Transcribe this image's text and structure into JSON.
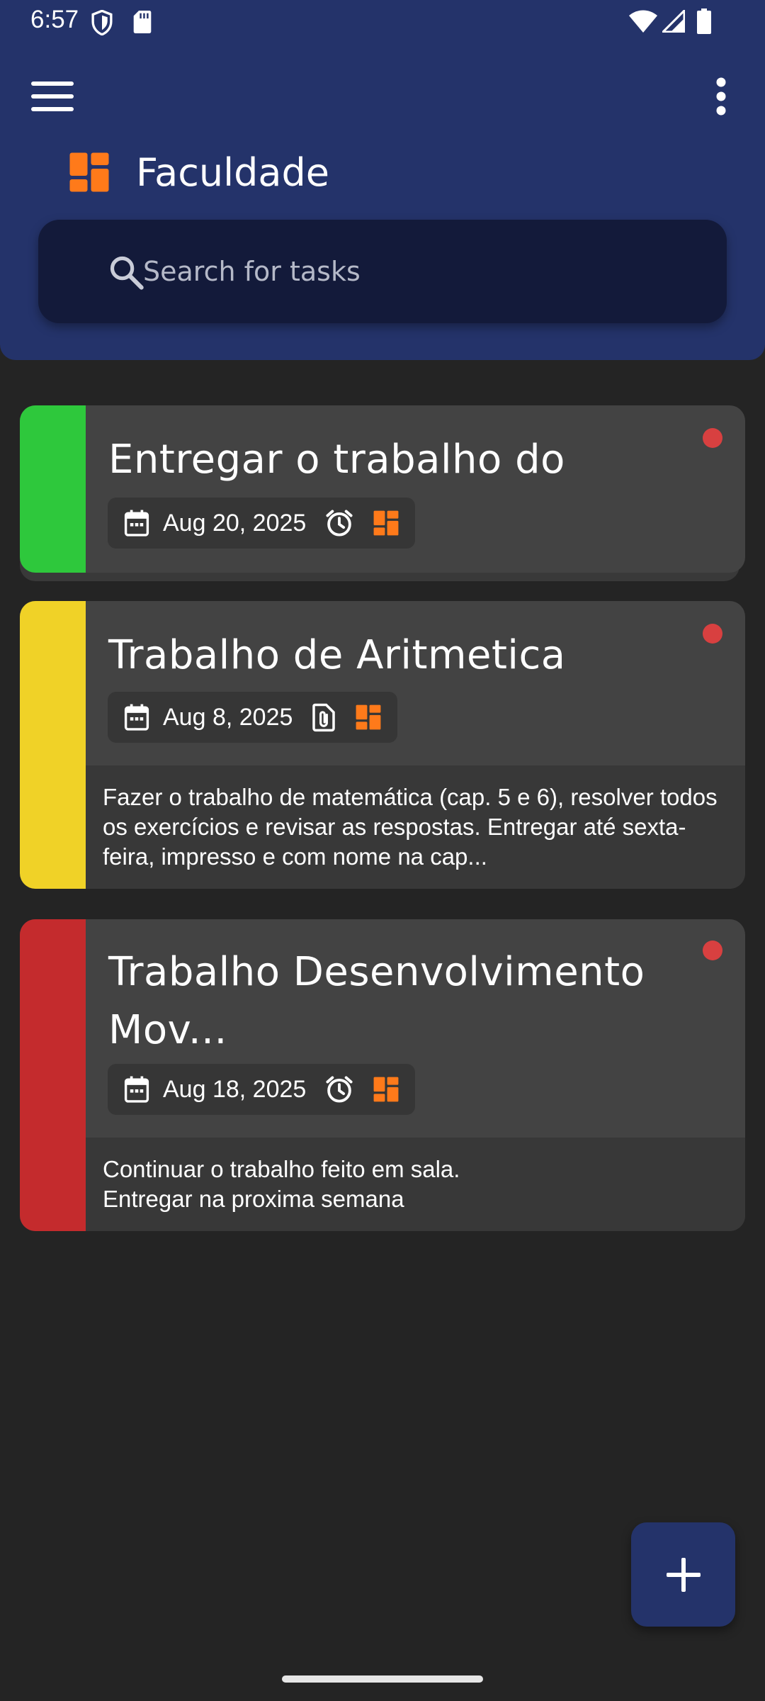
{
  "status_bar": {
    "time": "6:57",
    "icons": [
      "shield-icon",
      "sd-card-icon",
      "wifi-icon",
      "cell-signal-icon",
      "battery-icon"
    ]
  },
  "header": {
    "menu_icon": "hamburger-menu-icon",
    "more_icon": "more-vert-icon",
    "list_icon": "dashboard-icon",
    "title": "Faculdade",
    "search_placeholder": "Search for tasks"
  },
  "colors": {
    "header_bg": "#24336a",
    "background": "#242424",
    "card_bg": "#434343",
    "accent_orange": "#ff7a1a",
    "priority_dot": "#d84040"
  },
  "tasks": [
    {
      "title": "Entregar o trabalho do profe...",
      "date": "Aug 20, 2025",
      "stripe_color": "#2ec83c",
      "icons": [
        "calendar-icon",
        "alarm-icon",
        "dashboard-icon"
      ],
      "description": ""
    },
    {
      "title": "Trabalho de Aritmetica",
      "date": "Aug 8, 2025",
      "stripe_color": "#f0d227",
      "icons": [
        "calendar-icon",
        "attachment-icon",
        "dashboard-icon"
      ],
      "description": "Fazer o trabalho de matemática (cap. 5 e 6), resolver todos os exercícios e revisar as respostas. Entregar até sexta-feira, impresso e com nome na cap..."
    },
    {
      "title": "Trabalho Desenvolvimento Mov...",
      "date": "Aug 18, 2025",
      "stripe_color": "#c42b2d",
      "icons": [
        "calendar-icon",
        "alarm-icon",
        "dashboard-icon"
      ],
      "description": "Continuar o trabalho feito em sala.\nEntregar na proxima semana"
    }
  ],
  "fab": {
    "icon": "plus-icon"
  }
}
